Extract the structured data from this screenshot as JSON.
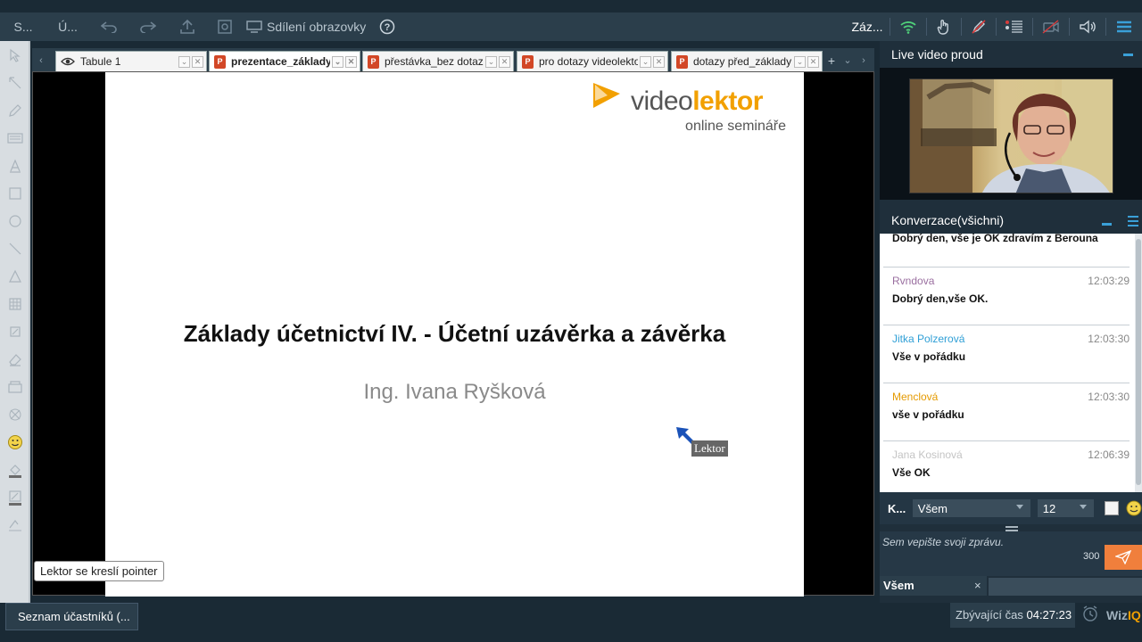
{
  "topbar": {
    "item1": "S...",
    "item2": "Ú...",
    "screen_share": "Sdílení obrazovky",
    "record": "Záz..."
  },
  "tabs": [
    {
      "label": "Tabule 1",
      "type": "whiteboard"
    },
    {
      "label": "prezentace_základy_ú",
      "type": "ppt"
    },
    {
      "label": "přestávka_bez dotazů",
      "type": "ppt"
    },
    {
      "label": "pro dotazy videolektor",
      "type": "ppt"
    },
    {
      "label": "dotazy před_základy",
      "type": "ppt"
    }
  ],
  "slide": {
    "logo_video": "video",
    "logo_lektor": "lektor",
    "logo_sub": "online semináře",
    "title": "Základy účetnictví IV. - Účetní uzávěrka a závěrka",
    "author": "Ing. Ivana Ryšková",
    "pointer_label": "Lektor"
  },
  "notice": "Lektor se kreslí pointer",
  "video_panel": {
    "title": "Live video proud"
  },
  "chat": {
    "title": "Konverzace(všichni)",
    "messages": [
      {
        "who": "",
        "time": "",
        "text": "Dobrý den, vše je OK zdravím z Berouna",
        "color": "#111111"
      },
      {
        "who": "Rvndova",
        "time": "12:03:29",
        "text": "Dobrý den,vše OK.",
        "color": "#9a6fa0"
      },
      {
        "who": "Jitka Polzerová",
        "time": "12:03:30",
        "text": "Vše v pořádku",
        "color": "#2f9fd6"
      },
      {
        "who": "Menclová",
        "time": "12:03:30",
        "text": "vše v pořádku",
        "color": "#e59a00"
      },
      {
        "who": "Jana Kosinová",
        "time": "12:06:39",
        "text": "Vše OK",
        "color": "#c4c4c4"
      }
    ],
    "send_label": "K...",
    "recipient": "Všem",
    "font_size": "12",
    "placeholder": "Sem vepište svoji zprávu.",
    "counter": "300",
    "recipient_tag": "Všem",
    "recipient_tag_close": "×"
  },
  "bottombar": {
    "participants": "Seznam účastníků (...",
    "timer_label": "Zbývající čas",
    "timer_value": "04:27:23",
    "brand_a": "Wiz",
    "brand_b": "IQ"
  }
}
